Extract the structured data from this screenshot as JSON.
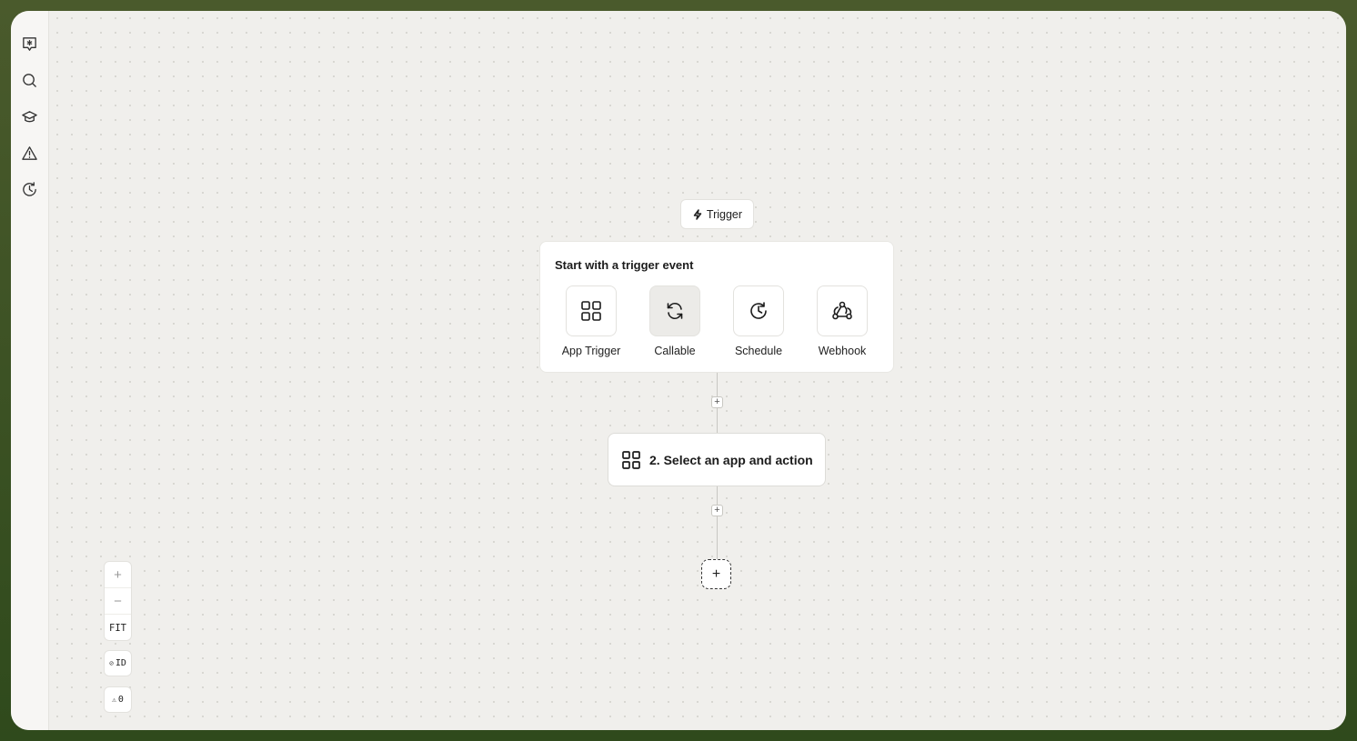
{
  "sidebar": {
    "items": [
      {
        "icon": "sparkle-chat-icon"
      },
      {
        "icon": "search-icon"
      },
      {
        "icon": "graduation-cap-icon"
      },
      {
        "icon": "warning-icon"
      },
      {
        "icon": "history-icon"
      }
    ]
  },
  "trigger_chip": {
    "label": "Trigger",
    "icon": "lightning-icon"
  },
  "trigger_card": {
    "title": "Start with a trigger event",
    "options": [
      {
        "label": "App Trigger",
        "icon": "grid-icon",
        "selected": false
      },
      {
        "label": "Callable",
        "icon": "refresh-icon",
        "selected": true
      },
      {
        "label": "Schedule",
        "icon": "clock-icon",
        "selected": false
      },
      {
        "label": "Webhook",
        "icon": "webhook-icon",
        "selected": false
      }
    ]
  },
  "connectors": {
    "plus": "+"
  },
  "action_card": {
    "label": "2. Select an app and action",
    "icon": "grid-icon"
  },
  "add_step": {
    "label": "+"
  },
  "controls": {
    "zoom_in": "+",
    "zoom_out": "−",
    "fit": "FIT",
    "id_toggle": "ID",
    "warnings": "0"
  }
}
